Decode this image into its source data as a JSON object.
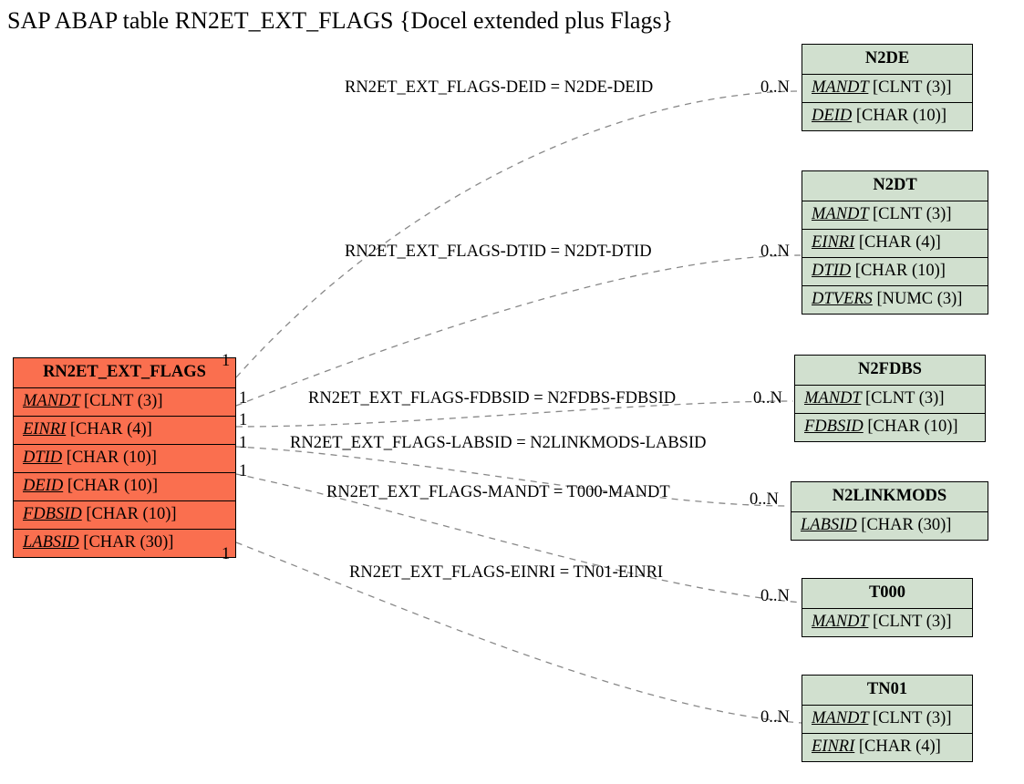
{
  "title": "SAP ABAP table RN2ET_EXT_FLAGS {Docel extended plus Flags}",
  "main": {
    "name": "RN2ET_EXT_FLAGS",
    "fields": [
      {
        "name": "MANDT",
        "type": "[CLNT (3)]"
      },
      {
        "name": "EINRI",
        "type": "[CHAR (4)]"
      },
      {
        "name": "DTID",
        "type": "[CHAR (10)]"
      },
      {
        "name": "DEID",
        "type": "[CHAR (10)]"
      },
      {
        "name": "FDBSID",
        "type": "[CHAR (10)]"
      },
      {
        "name": "LABSID",
        "type": "[CHAR (30)]"
      }
    ]
  },
  "targets": [
    {
      "name": "N2DE",
      "fields": [
        {
          "name": "MANDT",
          "type": "[CLNT (3)]"
        },
        {
          "name": "DEID",
          "type": "[CHAR (10)]"
        }
      ]
    },
    {
      "name": "N2DT",
      "fields": [
        {
          "name": "MANDT",
          "type": "[CLNT (3)]"
        },
        {
          "name": "EINRI",
          "type": "[CHAR (4)]"
        },
        {
          "name": "DTID",
          "type": "[CHAR (10)]"
        },
        {
          "name": "DTVERS",
          "type": "[NUMC (3)]"
        }
      ]
    },
    {
      "name": "N2FDBS",
      "fields": [
        {
          "name": "MANDT",
          "type": "[CLNT (3)]"
        },
        {
          "name": "FDBSID",
          "type": "[CHAR (10)]"
        }
      ]
    },
    {
      "name": "N2LINKMODS",
      "fields": [
        {
          "name": "LABSID",
          "type": "[CHAR (30)]"
        }
      ]
    },
    {
      "name": "T000",
      "fields": [
        {
          "name": "MANDT",
          "type": "[CLNT (3)]"
        }
      ]
    },
    {
      "name": "TN01",
      "fields": [
        {
          "name": "MANDT",
          "type": "[CLNT (3)]"
        },
        {
          "name": "EINRI",
          "type": "[CHAR (4)]"
        }
      ]
    }
  ],
  "relations": [
    {
      "label": "RN2ET_EXT_FLAGS-DEID = N2DE-DEID",
      "left": "1",
      "right": "0..N"
    },
    {
      "label": "RN2ET_EXT_FLAGS-DTID = N2DT-DTID",
      "left": "1",
      "right": "0..N"
    },
    {
      "label": "RN2ET_EXT_FLAGS-FDBSID = N2FDBS-FDBSID",
      "left": "1",
      "right": "0..N"
    },
    {
      "label": "RN2ET_EXT_FLAGS-LABSID = N2LINKMODS-LABSID",
      "left": "1",
      "right": "0..N"
    },
    {
      "label": "RN2ET_EXT_FLAGS-MANDT = T000-MANDT",
      "left": "1",
      "right": "0..N"
    },
    {
      "label": "RN2ET_EXT_FLAGS-EINRI = TN01-EINRI",
      "left": "1",
      "right": "0..N"
    }
  ]
}
